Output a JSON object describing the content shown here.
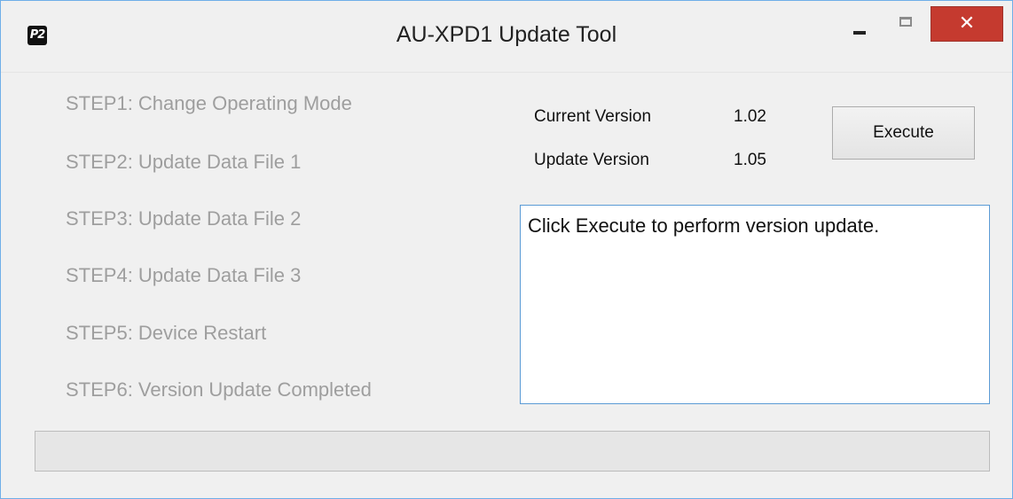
{
  "window": {
    "title": "AU-XPD1 Update Tool",
    "app_icon_text": "P2",
    "close_glyph": "✕"
  },
  "steps": [
    "STEP1: Change Operating Mode",
    "STEP2: Update Data File 1",
    "STEP3: Update Data File 2",
    "STEP4: Update Data File 3",
    "STEP5: Device Restart",
    "STEP6: Version Update Completed"
  ],
  "versions": {
    "current_label": "Current Version",
    "current_value": "1.02",
    "update_label": "Update Version",
    "update_value": "1.05"
  },
  "execute_button": "Execute",
  "message": "Click Execute to perform version update.",
  "progress": {
    "value": 0
  },
  "colors": {
    "step_disabled_text": "#9e9e9e",
    "close_button": "#c53a2f",
    "message_border": "#5b9bd5",
    "progress_fill": "#06b025"
  }
}
